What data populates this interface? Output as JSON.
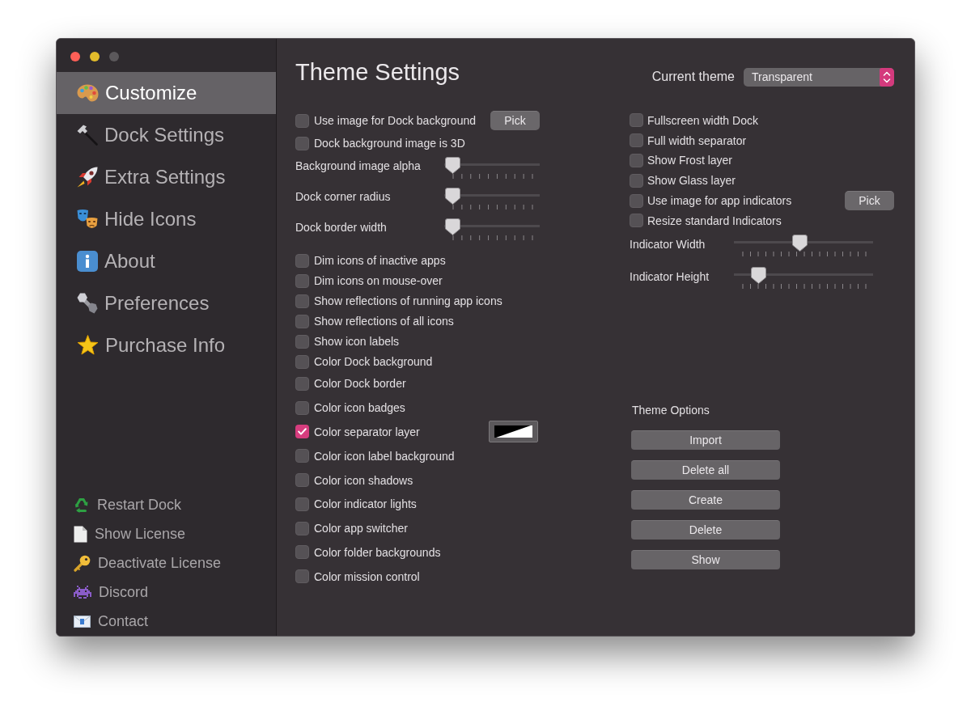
{
  "window": {
    "controls": [
      {
        "kind": "close",
        "disabled": false
      },
      {
        "kind": "minimize",
        "disabled": false
      },
      {
        "kind": "zoom",
        "disabled": true
      }
    ]
  },
  "sidebar": {
    "items": [
      {
        "label": "Customize",
        "selected": true
      },
      {
        "label": "Dock Settings",
        "selected": false
      },
      {
        "label": "Extra Settings",
        "selected": false
      },
      {
        "label": "Hide Icons",
        "selected": false
      },
      {
        "label": "About",
        "selected": false
      },
      {
        "label": "Preferences",
        "selected": false
      },
      {
        "label": "Purchase Info",
        "selected": false
      }
    ],
    "links": [
      {
        "label": "Restart Dock"
      },
      {
        "label": "Show License"
      },
      {
        "label": "Deactivate License"
      },
      {
        "label": "Discord"
      },
      {
        "label": "Contact"
      }
    ]
  },
  "title": "Theme Settings",
  "current_theme": {
    "label": "Current theme",
    "value": "Transparent"
  },
  "left_column": {
    "checkboxes": [
      {
        "label": "Use image for Dock background",
        "checked": false,
        "button": "Pick"
      },
      {
        "label": "Dock background image is 3D",
        "checked": false
      }
    ],
    "sliders": [
      {
        "label": "Background image alpha",
        "level": 0
      },
      {
        "label": "Dock corner radius",
        "level": 0
      },
      {
        "label": "Dock border width",
        "level": 0
      }
    ],
    "options": [
      {
        "kind": "checkbox",
        "label": "Dim icons of inactive apps",
        "checked": false
      },
      {
        "kind": "checkbox",
        "label": "Dim icons on mouse-over",
        "checked": false
      },
      {
        "kind": "checkbox",
        "label": "Show reflections of running app icons",
        "checked": false
      },
      {
        "kind": "checkbox",
        "label": "Show reflections of all icons",
        "checked": false
      },
      {
        "kind": "checkbox",
        "label": "Show icon labels",
        "checked": false
      },
      {
        "kind": "checkbox",
        "label": "Color Dock background",
        "checked": false
      },
      {
        "kind": "checkbox",
        "label": "Color Dock border",
        "checked": false
      },
      {
        "kind": "checkbox",
        "label": "Color icon badges",
        "checked": false
      },
      {
        "kind": "color_checkbox",
        "label": "Color separator layer",
        "checked": true
      },
      {
        "kind": "checkbox",
        "label": "Color icon label background",
        "checked": false
      },
      {
        "kind": "checkbox",
        "label": "Color icon shadows",
        "checked": false
      },
      {
        "kind": "checkbox",
        "label": "Color indicator lights",
        "checked": false
      },
      {
        "kind": "checkbox",
        "label": "Color app switcher",
        "checked": false
      },
      {
        "kind": "checkbox",
        "label": "Color folder backgrounds",
        "checked": false
      },
      {
        "kind": "checkbox",
        "label": "Color mission control",
        "checked": false
      }
    ]
  },
  "right_column": {
    "checkboxes": [
      {
        "label": "Fullscreen width Dock",
        "checked": false
      },
      {
        "label": "Full width separator",
        "checked": false
      },
      {
        "label": "Show Frost layer",
        "checked": false
      },
      {
        "label": "Show Glass layer",
        "checked": false
      },
      {
        "label": "Use image for app indicators",
        "checked": false,
        "button": "Pick"
      },
      {
        "label": "Resize standard Indicators",
        "checked": false
      }
    ],
    "sliders": [
      {
        "label": "Indicator Width",
        "level": 0.47
      },
      {
        "label": "Indicator Height",
        "level": 0.13
      }
    ],
    "theme_options": {
      "title": "Theme Options",
      "buttons": [
        "Import",
        "Delete all",
        "Create",
        "Delete",
        "Show"
      ]
    }
  }
}
